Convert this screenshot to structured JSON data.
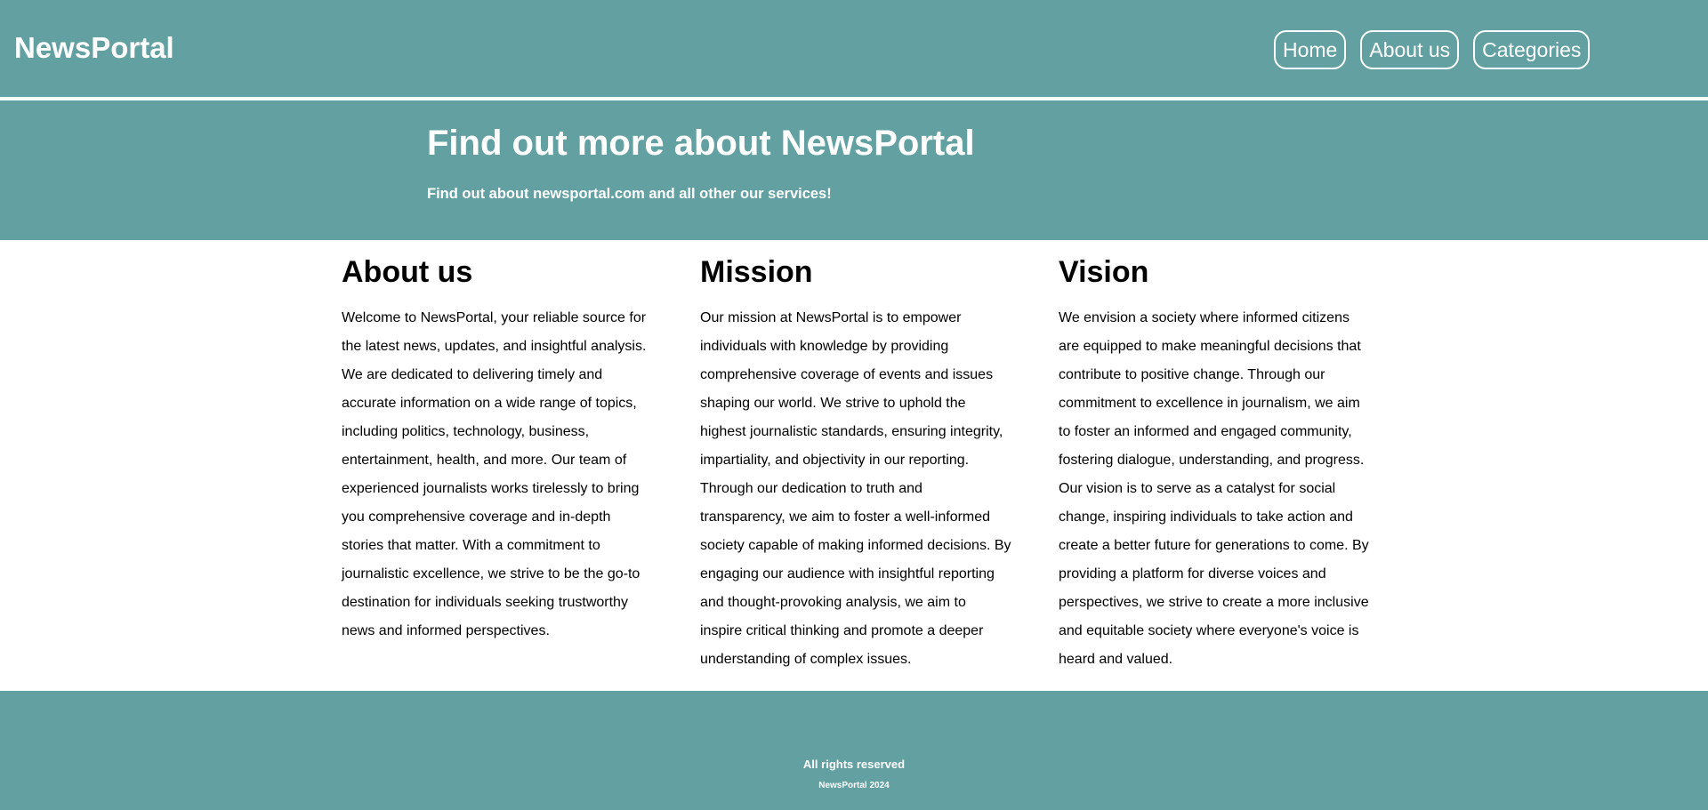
{
  "header": {
    "brand": "NewsPortal",
    "nav": [
      {
        "label": "Home"
      },
      {
        "label": "About us"
      },
      {
        "label": "Categories"
      }
    ]
  },
  "hero": {
    "title": "Find out more about NewsPortal",
    "subtitle": "Find out about newsportal.com and all other our services!"
  },
  "sections": [
    {
      "heading": "About us",
      "body": "Welcome to NewsPortal, your reliable source for the latest news, updates, and insightful analysis. We are dedicated to delivering timely and accurate information on a wide range of topics, including politics, technology, business, entertainment, health, and more. Our team of experienced journalists works tirelessly to bring you comprehensive coverage and in-depth stories that matter. With a commitment to journalistic excellence, we strive to be the go-to destination for individuals seeking trustworthy news and informed perspectives."
    },
    {
      "heading": "Mission",
      "body": "Our mission at NewsPortal is to empower individuals with knowledge by providing comprehensive coverage of events and issues shaping our world. We strive to uphold the highest journalistic standards, ensuring integrity, impartiality, and objectivity in our reporting. Through our dedication to truth and transparency, we aim to foster a well-informed society capable of making informed decisions. By engaging our audience with insightful reporting and thought-provoking analysis, we aim to inspire critical thinking and promote a deeper understanding of complex issues."
    },
    {
      "heading": "Vision",
      "body": "We envision a society where informed citizens are equipped to make meaningful decisions that contribute to positive change. Through our commitment to excellence in journalism, we aim to foster an informed and engaged community, fostering dialogue, understanding, and progress. Our vision is to serve as a catalyst for social change, inspiring individuals to take action and create a better future for generations to come. By providing a platform for diverse voices and perspectives, we strive to create a more inclusive and equitable society where everyone's voice is heard and valued."
    }
  ],
  "footer": {
    "rights": "All rights reserved",
    "copyright": "NewsPortal 2024"
  },
  "colors": {
    "teal": "#62a0a1",
    "text_light": "#ffffff",
    "text_dark": "#000000"
  }
}
